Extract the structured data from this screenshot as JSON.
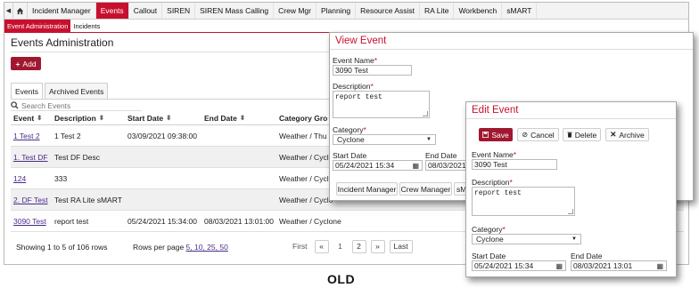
{
  "nav": {
    "items": [
      "Incident Manager",
      "Events",
      "Callout",
      "SIREN",
      "SIREN Mass Calling",
      "Crew Mgr",
      "Planning",
      "Resource Assist",
      "RA Lite",
      "Workbench",
      "sMART"
    ],
    "active": "Events"
  },
  "subnav": {
    "items": [
      "Event Administration",
      "Incidents"
    ]
  },
  "page": {
    "title": "Events Administration",
    "add_label": "Add"
  },
  "tabs": [
    "Events",
    "Archived Events"
  ],
  "search": {
    "placeholder": "Search Events"
  },
  "table": {
    "headers": [
      "Event",
      "Description",
      "Start Date",
      "End Date",
      "Category Gro"
    ],
    "rows": [
      {
        "event": "1 Test 2",
        "description": "1 Test 2",
        "start": "03/09/2021 09:38:00",
        "end": "",
        "category": "Weather / Thu"
      },
      {
        "event": "1. Test DF",
        "description": "Test DF Desc",
        "start": "",
        "end": "",
        "category": "Weather / Cyclo"
      },
      {
        "event": "124",
        "description": "333",
        "start": "",
        "end": "",
        "category": "Weather / Cyclo"
      },
      {
        "event": "2. DF Test",
        "description": "Test RA Lite sMART",
        "start": "",
        "end": "",
        "category": "Weather / Cyclo"
      },
      {
        "event": "3090 Test",
        "description": "report test",
        "start": "05/24/2021 15:34:00",
        "end": "08/03/2021 13:01:00",
        "category": "Weather / Cyclone"
      }
    ]
  },
  "footer": {
    "showing": "Showing 1 to 5 of 106 rows",
    "rows_per_page_label": "Rows per page",
    "rows_per_page_options": "5, 10, 25, 50",
    "pager": {
      "first": "First",
      "prev": "«",
      "p1": "1",
      "p2": "2",
      "next": "»",
      "last": "Last"
    }
  },
  "view_event": {
    "title": "View Event",
    "event_name_label": "Event Name",
    "event_name": "3090 Test",
    "description_label": "Description",
    "description": "report test",
    "category_label": "Category",
    "category": "Cyclone",
    "start_label": "Start Date",
    "start": "05/24/2021 15:34",
    "end_label": "End Date",
    "end": "08/03/2021",
    "buttons": [
      "Incident Manager",
      "Crew Manager",
      "sMART"
    ]
  },
  "edit_event": {
    "title": "Edit Event",
    "save": "Save",
    "cancel": "Cancel",
    "delete": "Delete",
    "archive": "Archive",
    "event_name_label": "Event Name",
    "event_name": "3090 Test",
    "description_label": "Description",
    "description": "report test",
    "category_label": "Category",
    "category": "Cyclone",
    "start_label": "Start Date",
    "start": "05/24/2021 15:34",
    "end_label": "End Date",
    "end": "08/03/2021 13:01"
  },
  "required_mark": "*",
  "caption": "OLD",
  "colors": {
    "brand_red": "#c8102e",
    "button_red": "#a0182f",
    "link": "#4a2c8a"
  },
  "icons": {
    "edit": "pencil-icon",
    "delete": "trash-icon",
    "archive": "archive-icon",
    "calendar": "calendar-icon",
    "home": "home-icon"
  }
}
